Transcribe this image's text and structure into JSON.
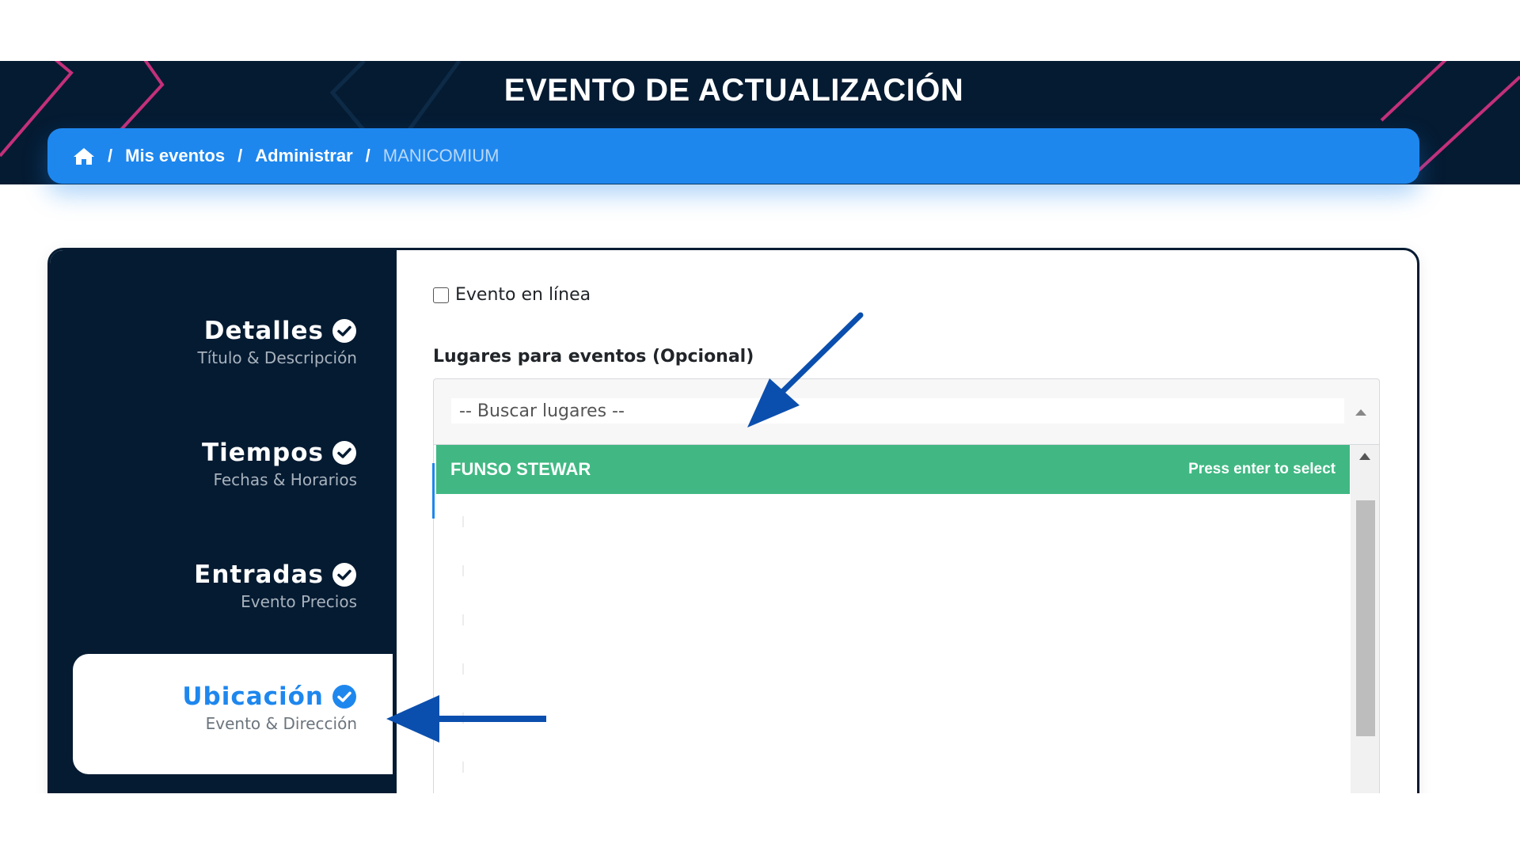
{
  "header": {
    "title": "EVENTO DE ACTUALIZACIÓN",
    "breadcrumb": {
      "home_icon": "home-icon",
      "separator": "/",
      "items": [
        "Mis eventos",
        "Administrar",
        "MANICOMIUM"
      ]
    }
  },
  "sidebar": {
    "steps": [
      {
        "title": "Detalles",
        "subtitle": "Título & Descripción",
        "icon": "check-circle-icon"
      },
      {
        "title": "Tiempos",
        "subtitle": "Fechas & Horarios",
        "icon": "check-circle-icon"
      },
      {
        "title": "Entradas",
        "subtitle": "Evento Precios",
        "icon": "check-circle-icon"
      },
      {
        "title": "Ubicación",
        "subtitle": "Evento & Dirección",
        "icon": "check-circle-icon",
        "active": true
      }
    ]
  },
  "form": {
    "online_event_label": "Evento en línea",
    "online_event_checked": false,
    "venues_label": "Lugares para eventos (Opcional)",
    "venues_placeholder": "-- Buscar lugares --",
    "dropdown": {
      "highlighted_option": "FUNSO STEWAR",
      "select_hint": "Press enter to select"
    }
  },
  "colors": {
    "navy": "#051b32",
    "primary_blue": "#1e87ee",
    "highlight_green": "#41b883",
    "annotation_arrow": "#0b4fae"
  }
}
